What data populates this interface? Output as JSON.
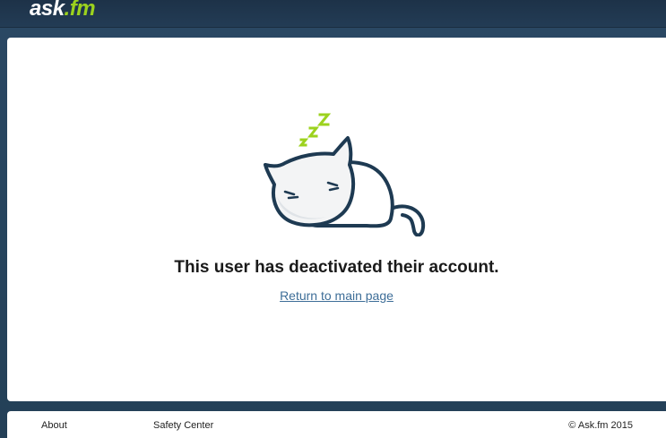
{
  "header": {
    "logo_main": "ask",
    "logo_dot": ".",
    "logo_suffix": "fm"
  },
  "main": {
    "illustration_icon": "sleeping-cat-icon",
    "message": "This user has deactivated their account.",
    "return_link": "Return to main page"
  },
  "footer": {
    "about": "About",
    "safety_center": "Safety Center",
    "copyright": "© Ask.fm 2015"
  },
  "colors": {
    "header_bg": "#1d3248",
    "page_bg": "#27455f",
    "accent_green": "#9cd21e",
    "link": "#3e6e98",
    "cat_outline": "#1e3a52"
  }
}
